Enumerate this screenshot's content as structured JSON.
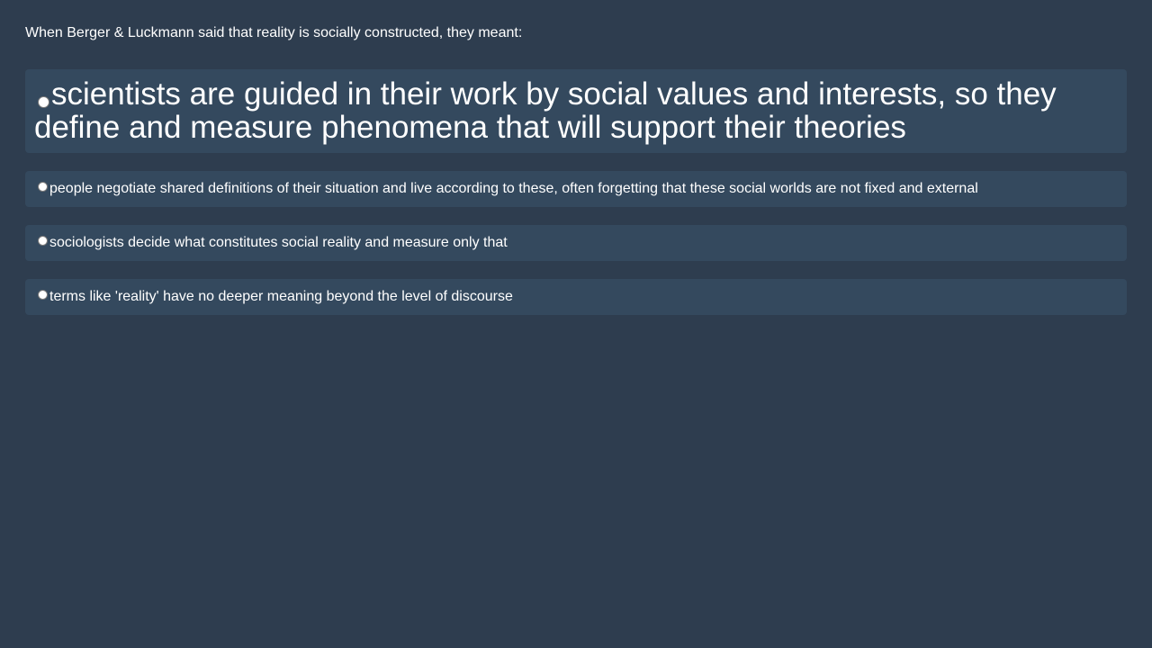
{
  "question": {
    "text": "When Berger & Luckmann said that reality is socially constructed, they meant:"
  },
  "options": [
    {
      "label": "scientists are guided in their work by social values and interests, so they define and measure phenomena that will support their theories",
      "selected": false
    },
    {
      "label": "people negotiate shared definitions of their situation and live according to these, often forgetting that these social worlds are not fixed and external",
      "selected": false
    },
    {
      "label": "sociologists decide what constitutes social reality and measure only that",
      "selected": false
    },
    {
      "label": "terms like 'reality' have no deeper meaning beyond the level of discourse",
      "selected": false
    }
  ],
  "colors": {
    "background": "#2e3d4f",
    "option_background": "#34495e",
    "text": "#ffffff"
  }
}
